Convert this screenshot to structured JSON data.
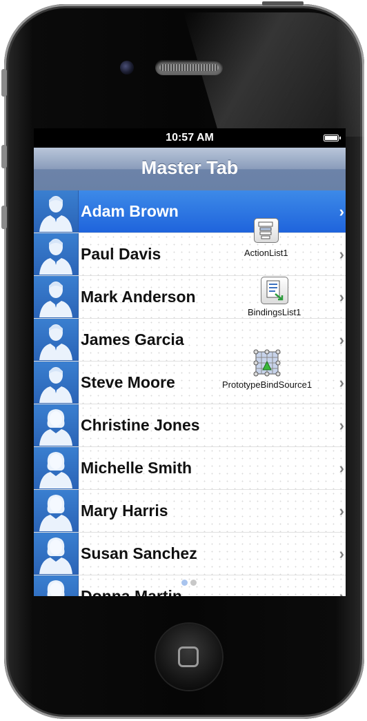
{
  "status_bar": {
    "time": "10:57 AM"
  },
  "nav": {
    "title": "Master Tab"
  },
  "contacts": [
    {
      "name": "Adam Brown",
      "gender": "male",
      "selected": true
    },
    {
      "name": "Paul Davis",
      "gender": "male"
    },
    {
      "name": "Mark Anderson",
      "gender": "male"
    },
    {
      "name": "James Garcia",
      "gender": "male"
    },
    {
      "name": "Steve Moore",
      "gender": "male"
    },
    {
      "name": "Christine Jones",
      "gender": "female"
    },
    {
      "name": "Michelle Smith",
      "gender": "female"
    },
    {
      "name": "Mary Harris",
      "gender": "female"
    },
    {
      "name": "Susan Sanchez",
      "gender": "female"
    },
    {
      "name": "Donna Martin",
      "gender": "female"
    }
  ],
  "components": {
    "action_list": {
      "label": "ActionList1",
      "icon": "action-list-icon"
    },
    "bindings_list": {
      "label": "BindingsList1",
      "icon": "bindings-list-icon"
    },
    "bind_source": {
      "label": "PrototypeBindSource1",
      "icon": "bind-source-icon"
    }
  },
  "chevron": "›",
  "colors": {
    "selected_row": "#2a6fe0",
    "avatar_bg": "#2f6fc4",
    "nav_bar": "#7b8fb2"
  }
}
